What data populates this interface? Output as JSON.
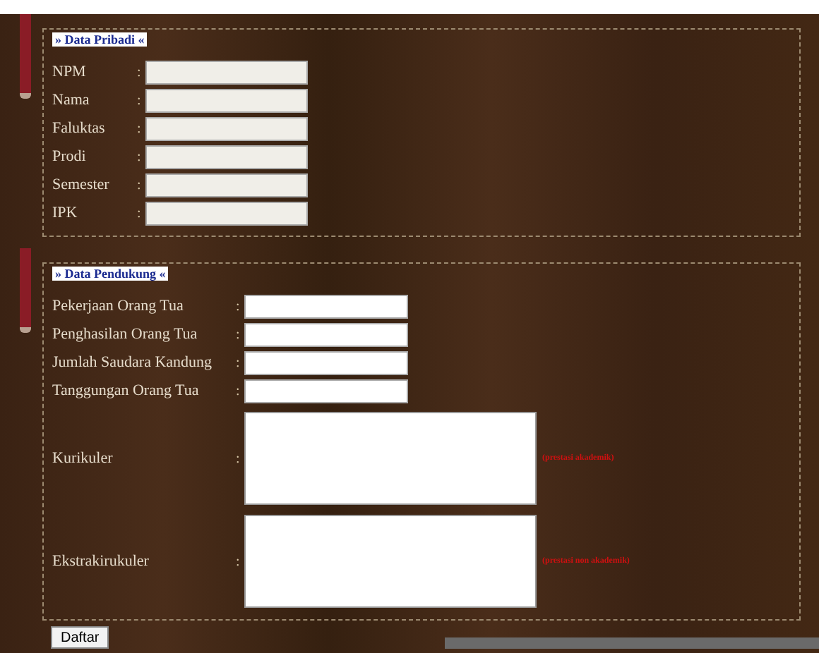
{
  "sections": [
    {
      "legend": "» Data Pribadi «",
      "fields": [
        {
          "label": "NPM",
          "kind": "input"
        },
        {
          "label": "Nama",
          "kind": "input"
        },
        {
          "label": "Faluktas",
          "kind": "input"
        },
        {
          "label": "Prodi",
          "kind": "input"
        },
        {
          "label": "Semester",
          "kind": "input"
        },
        {
          "label": "IPK",
          "kind": "input"
        }
      ]
    },
    {
      "legend": "» Data Pendukung «",
      "fields": [
        {
          "label": "Pekerjaan Orang Tua",
          "kind": "input"
        },
        {
          "label": "Penghasilan Orang Tua",
          "kind": "input"
        },
        {
          "label": "Jumlah Saudara Kandung",
          "kind": "input"
        },
        {
          "label": "Tanggungan Orang Tua",
          "kind": "input"
        },
        {
          "label": "Kurikuler",
          "kind": "textarea",
          "note": "(prestasi akademik)"
        },
        {
          "label": "Ekstrakirukuler",
          "kind": "textarea",
          "note": "(prestasi non akademik)"
        }
      ]
    }
  ],
  "separator": ":",
  "submit": "Daftar"
}
